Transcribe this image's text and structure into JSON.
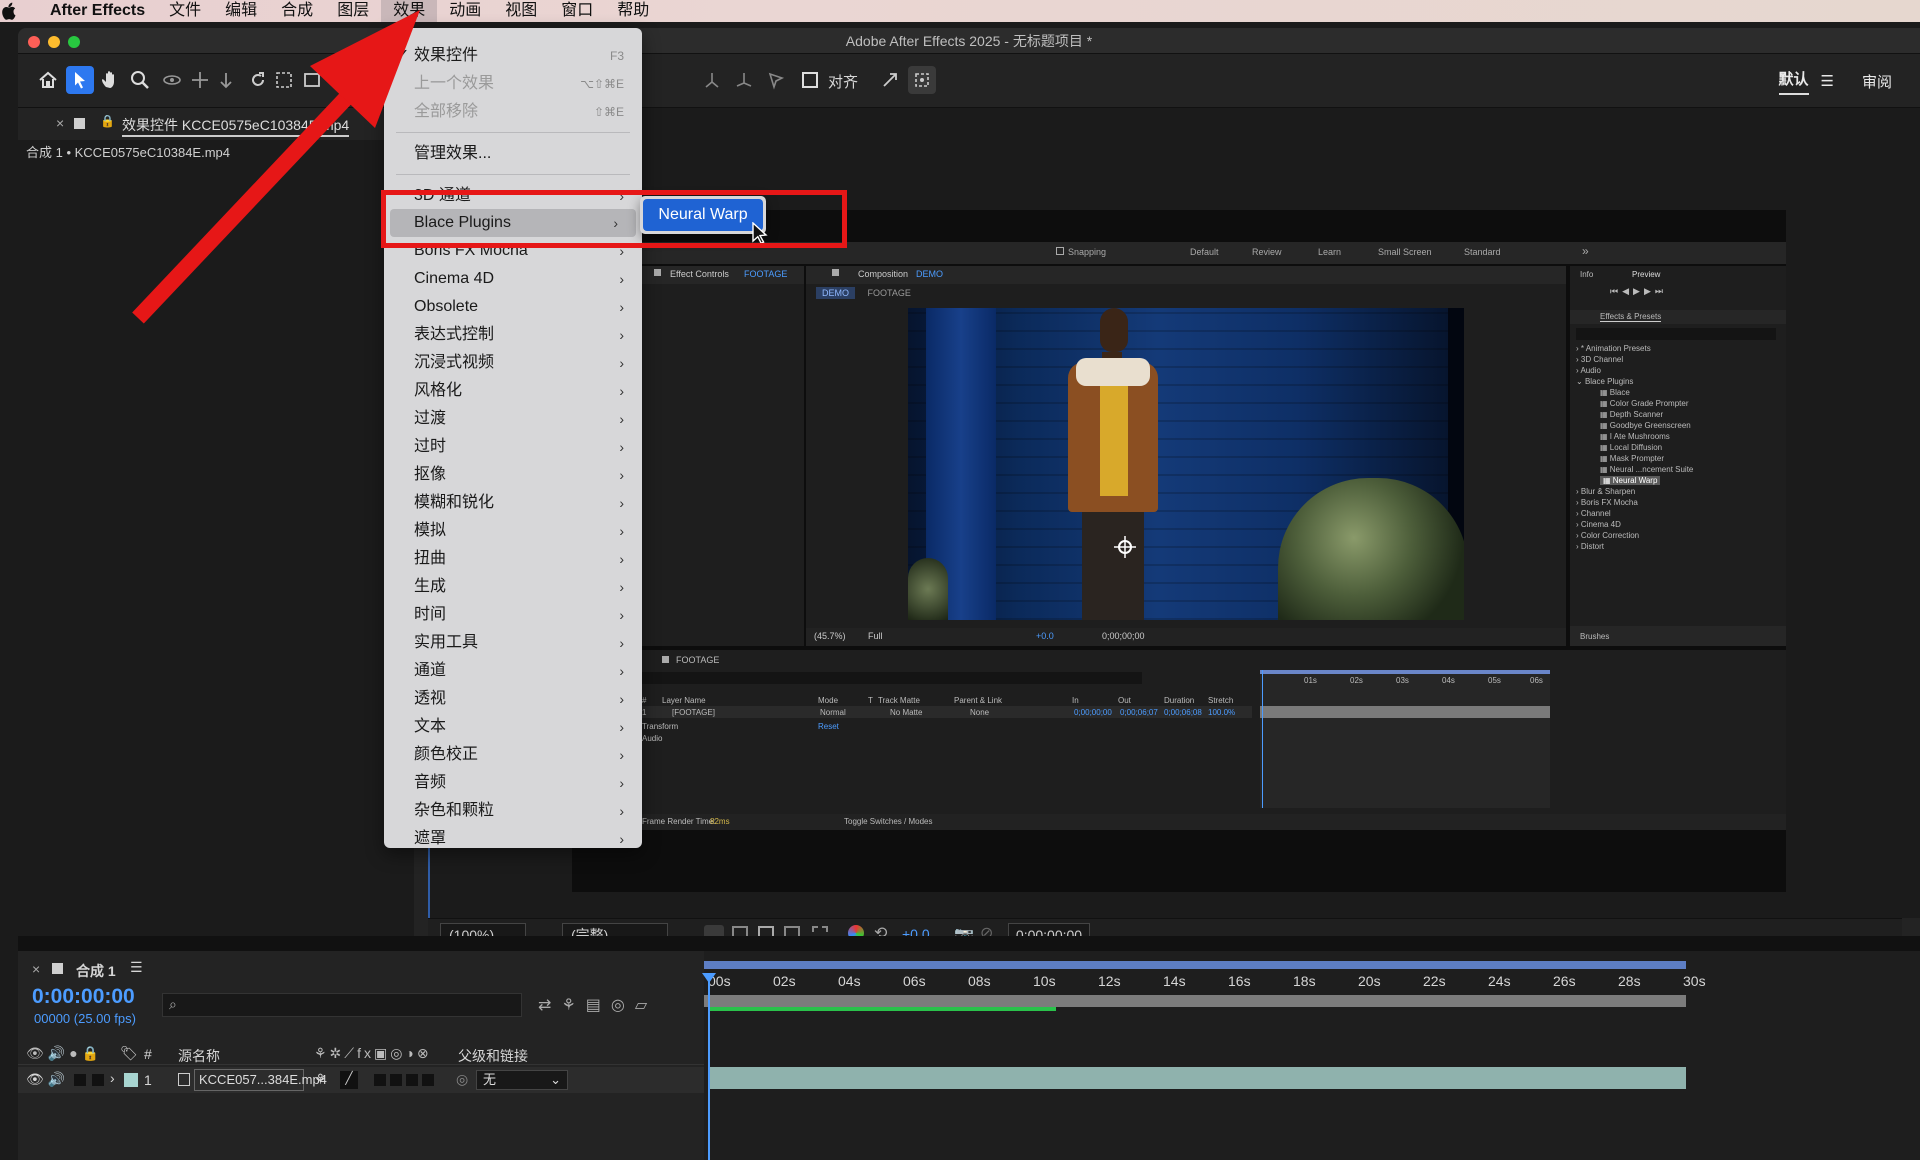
{
  "menubar": {
    "apple_icon": "apple-logo-icon",
    "app_name": "After Effects",
    "items": [
      "文件",
      "编辑",
      "合成",
      "图层",
      "效果",
      "动画",
      "视图",
      "窗口",
      "帮助"
    ],
    "active_index": 4
  },
  "window": {
    "title": "Adobe After Effects 2025 - 无标题项目 *"
  },
  "toolbar": {
    "snap_label": "对齐",
    "workspaces": [
      "默认",
      "审阅"
    ],
    "workspace_menu_icon": "hamburger-icon"
  },
  "effect_controls": {
    "tab_label": "效果控件 KCCE0575eC10384E.mp4",
    "crumb": "合成 1 • KCCE0575eC10384E.mp4"
  },
  "effect_menu": {
    "items": [
      {
        "label": "效果控件",
        "shortcut": "F3",
        "checked": true
      },
      {
        "label": "上一个效果",
        "shortcut": "⌥⇧⌘E",
        "disabled": true
      },
      {
        "label": "全部移除",
        "shortcut": "⇧⌘E",
        "disabled": true
      },
      {
        "label": "管理效果..."
      },
      {
        "label": "3D 通道",
        "submenu": true
      },
      {
        "label": "Blace Plugins",
        "submenu": true,
        "highlighted": true
      },
      {
        "label": "Boris FX Mocha",
        "submenu": true
      },
      {
        "label": "Cinema 4D",
        "submenu": true
      },
      {
        "label": "Obsolete",
        "submenu": true
      },
      {
        "label": "表达式控制",
        "submenu": true
      },
      {
        "label": "沉浸式视频",
        "submenu": true
      },
      {
        "label": "风格化",
        "submenu": true
      },
      {
        "label": "过渡",
        "submenu": true
      },
      {
        "label": "过时",
        "submenu": true
      },
      {
        "label": "抠像",
        "submenu": true
      },
      {
        "label": "模糊和锐化",
        "submenu": true
      },
      {
        "label": "模拟",
        "submenu": true
      },
      {
        "label": "扭曲",
        "submenu": true
      },
      {
        "label": "生成",
        "submenu": true
      },
      {
        "label": "时间",
        "submenu": true
      },
      {
        "label": "实用工具",
        "submenu": true
      },
      {
        "label": "通道",
        "submenu": true
      },
      {
        "label": "透视",
        "submenu": true
      },
      {
        "label": "文本",
        "submenu": true
      },
      {
        "label": "颜色校正",
        "submenu": true
      },
      {
        "label": "音频",
        "submenu": true
      },
      {
        "label": "杂色和颗粒",
        "submenu": true
      },
      {
        "label": "遮罩",
        "submenu": true
      }
    ],
    "submenu_item": "Neural Warp",
    "accent_color": "#1f63d3",
    "annotation_color": "#e61717"
  },
  "nested": {
    "workspaces": [
      "Default",
      "Review",
      "Learn",
      "Small Screen",
      "Standard"
    ],
    "snapping": "Snapping",
    "effect_controls_tab": "Effect Controls",
    "effect_controls_layer": "FOOTAGE",
    "comp_tab": "Composition",
    "comp_name": "DEMO",
    "comp_breadcrumb": [
      "DEMO",
      "FOOTAGE"
    ],
    "viewer_zoom": "(45.7%)",
    "viewer_res": "Full",
    "viewer_offset": "+0.0",
    "viewer_time": "0;00;00;00",
    "info_tab": "Info",
    "preview_tab": "Preview",
    "fx_presets_tab": "Effects & Presets",
    "fx_tree": [
      {
        "label": "* Animation Presets",
        "level": 0
      },
      {
        "label": "3D Channel",
        "level": 0
      },
      {
        "label": "Audio",
        "level": 0
      },
      {
        "label": "Blace Plugins",
        "level": 0,
        "open": true
      },
      {
        "label": "Blace",
        "level": 1
      },
      {
        "label": "Color Grade Prompter",
        "level": 1
      },
      {
        "label": "Depth Scanner",
        "level": 1
      },
      {
        "label": "Goodbye Greenscreen",
        "level": 1
      },
      {
        "label": "I Ate Mushrooms",
        "level": 1
      },
      {
        "label": "Local Diffusion",
        "level": 1
      },
      {
        "label": "Mask Prompter",
        "level": 1
      },
      {
        "label": "Neural ...ncement Suite",
        "level": 1
      },
      {
        "label": "Neural Warp",
        "level": 1,
        "selected": true
      },
      {
        "label": "Blur & Sharpen",
        "level": 0
      },
      {
        "label": "Boris FX Mocha",
        "level": 0
      },
      {
        "label": "Channel",
        "level": 0
      },
      {
        "label": "Cinema 4D",
        "level": 0
      },
      {
        "label": "Color Correction",
        "level": 0
      },
      {
        "label": "Distort",
        "level": 0
      }
    ],
    "brushes_tab": "Brushes",
    "tl_tab": "FOOTAGE",
    "tl_headers": [
      "#",
      "Layer Name",
      "Mode",
      "T",
      "Track Matte",
      "Parent & Link",
      "In",
      "Out",
      "Duration",
      "Stretch"
    ],
    "tl_layer": {
      "num": "1",
      "name": "[FOOTAGE]",
      "mode": "Normal",
      "matte": "No Matte",
      "parent": "None",
      "in": "0;00;00;00",
      "out": "0;00;06;07",
      "duration": "0;00;06;08",
      "stretch": "100.0%"
    },
    "tl_props": [
      "Transform",
      "Audio"
    ],
    "tl_reset": "Reset",
    "tl_ruler": [
      "01s",
      "02s",
      "03s",
      "04s",
      "05s",
      "06s"
    ],
    "render_time_label": "Frame Render Time:",
    "render_time": "82ms",
    "toggle_label": "Toggle Switches / Modes"
  },
  "viewer_bar": {
    "zoom": "(100%)",
    "resolution": "(完整)",
    "exposure": "+0.0",
    "timecode": "0:00:00:00"
  },
  "timeline": {
    "tab": "合成 1",
    "timecode": "0:00:00:00",
    "frames": "00000 (25.00 fps)",
    "col_source": "源名称",
    "col_parent": "父级和链接",
    "col_num": "#",
    "layer": {
      "num": "1",
      "name": "KCCE057...384E.mp4",
      "parent": "无"
    },
    "ruler": [
      "00s",
      "02s",
      "04s",
      "06s",
      "08s",
      "10s",
      "12s",
      "14s",
      "16s",
      "18s",
      "20s",
      "22s",
      "24s",
      "26s",
      "28s",
      "30s"
    ]
  }
}
